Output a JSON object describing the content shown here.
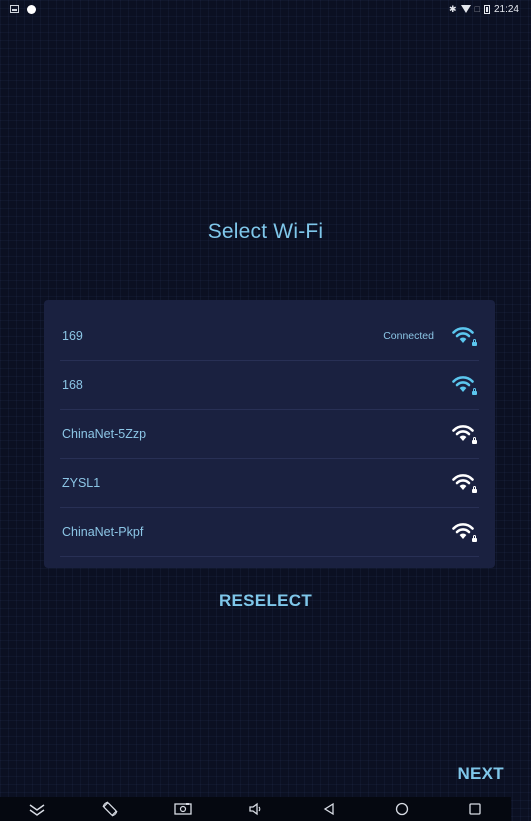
{
  "status_bar": {
    "time": "21:24",
    "icons": [
      "image-notification-icon",
      "dot-notification-icon",
      "bluetooth-icon",
      "wifi-signal-icon",
      "no-sim-icon",
      "battery-icon"
    ]
  },
  "title": "Select Wi-Fi",
  "networks": [
    {
      "ssid": "169",
      "status": "Connected",
      "secured": true,
      "icon_color": "#5bc6ee"
    },
    {
      "ssid": "168",
      "status": "",
      "secured": true,
      "icon_color": "#5bc6ee"
    },
    {
      "ssid": "ChinaNet-5Zzp",
      "status": "",
      "secured": true,
      "icon_color": "#ffffff"
    },
    {
      "ssid": "ZYSL1",
      "status": "",
      "secured": true,
      "icon_color": "#ffffff"
    },
    {
      "ssid": "ChinaNet-Pkpf",
      "status": "",
      "secured": true,
      "icon_color": "#ffffff"
    }
  ],
  "actions": {
    "reselect_label": "RESELECT",
    "next_label": "NEXT"
  },
  "nav_bar": {
    "buttons": [
      "collapse-icon",
      "rotate-icon",
      "screenshot-icon",
      "volume-icon",
      "back-icon",
      "home-icon",
      "recents-icon"
    ]
  },
  "colors": {
    "background": "#0b1022",
    "card": "#1a2140",
    "accent": "#7fc7ea"
  }
}
